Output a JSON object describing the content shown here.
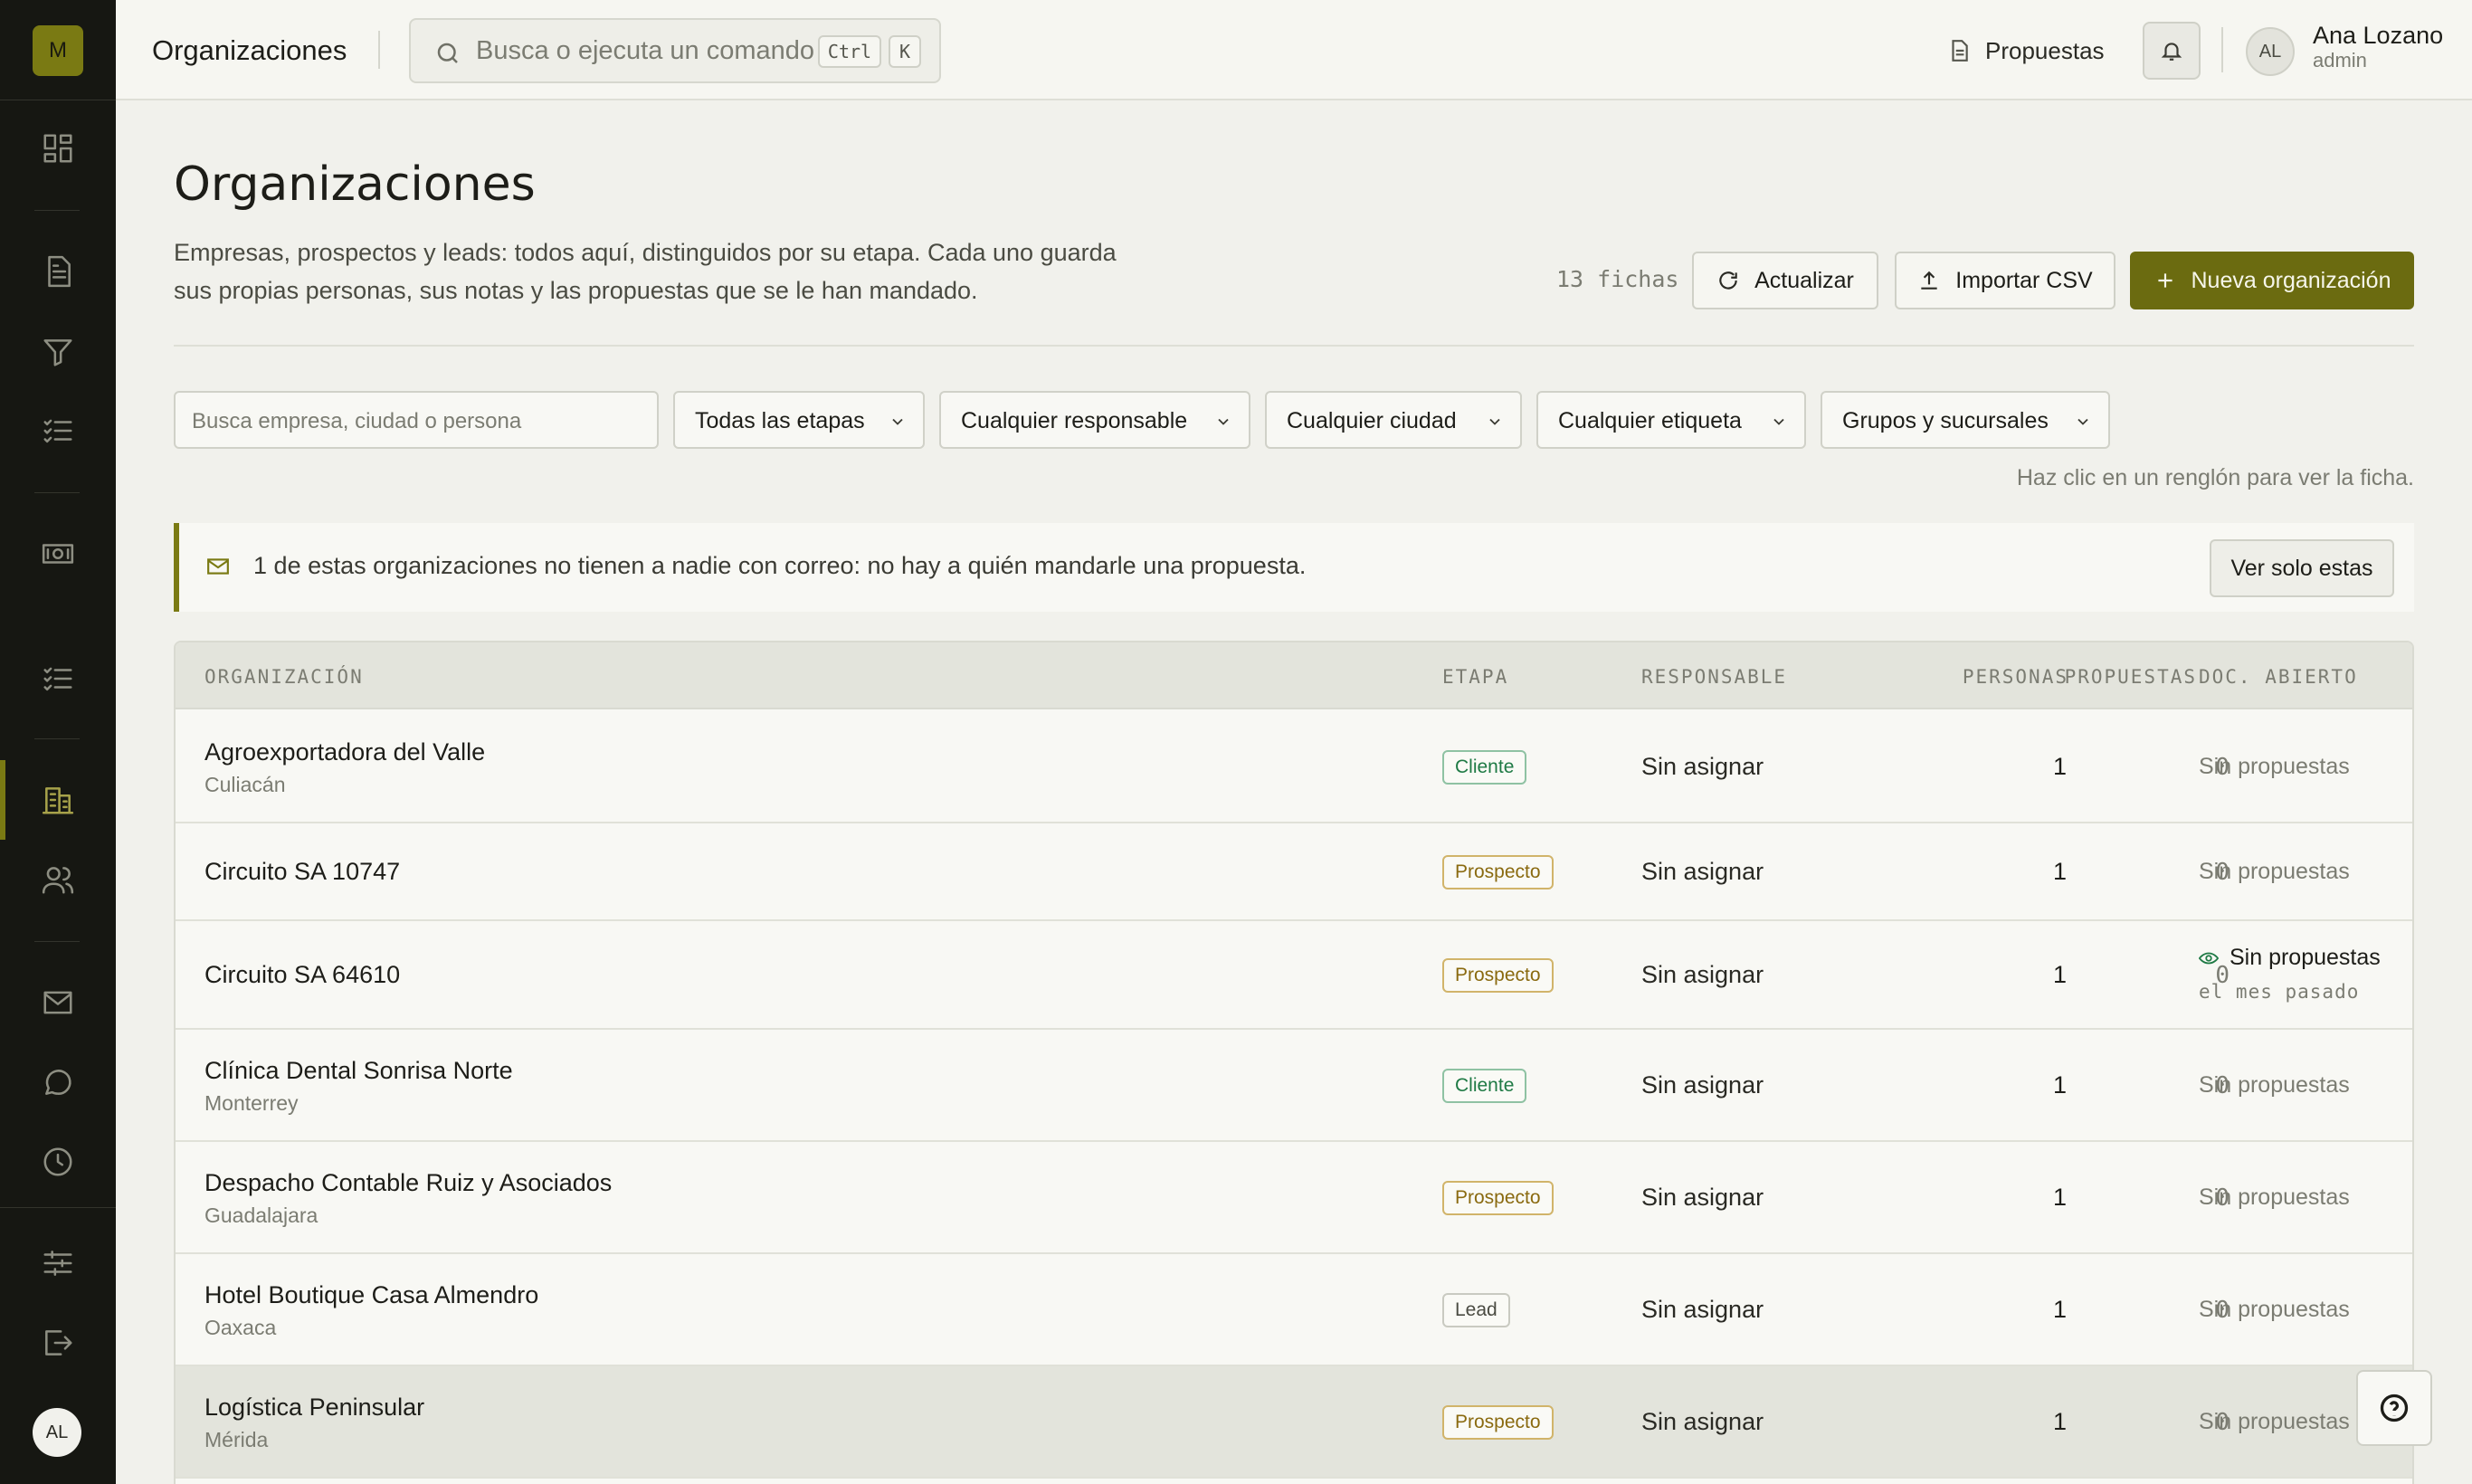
{
  "brand": {
    "logo_letter": "M"
  },
  "topbar": {
    "title": "Organizaciones",
    "search_placeholder": "Busca o ejecuta un comando",
    "kbd_ctrl": "Ctrl",
    "kbd_k": "K",
    "proposals_link": "Propuestas",
    "user_initials": "AL",
    "user_name": "Ana Lozano",
    "user_role": "admin"
  },
  "sidebar": {
    "icons": [
      "dashboard-icon",
      "document-icon",
      "funnel-icon",
      "checklist-icon",
      "banknote-icon",
      "tasks-icon",
      "building-icon",
      "people-icon",
      "mail-icon",
      "chat-icon",
      "clock-icon",
      "sliders-icon",
      "logout-icon"
    ],
    "active": "building-icon",
    "avatar_initials": "AL"
  },
  "page": {
    "title": "Organizaciones",
    "description": "Empresas, prospectos y leads: todos aquí, distinguidos por su etapa. Cada uno guarda sus propias personas, sus notas y las propuestas que se le han mandado.",
    "count": "13 fichas",
    "refresh_label": "Actualizar",
    "import_label": "Importar CSV",
    "new_label": "Nueva organización"
  },
  "filters": {
    "search_placeholder": "Busca empresa, ciudad o persona",
    "stage": "Todas las etapas",
    "owner": "Cualquier responsable",
    "city": "Cualquier ciudad",
    "tag": "Cualquier etiqueta",
    "groups": "Grupos y sucursales",
    "hint": "Haz clic en un renglón para ver la ficha."
  },
  "alert": {
    "count": "1",
    "message": "de estas organizaciones no tienen a nadie con correo: no hay a quién mandarle una propuesta.",
    "button": "Ver solo estas"
  },
  "table": {
    "headers": {
      "org": "ORGANIZACIÓN",
      "stage": "ETAPA",
      "owner": "RESPONSABLE",
      "people": "PERSONAS",
      "proposals": "PROPUESTAS",
      "doc": "DOC. ABIERTO"
    },
    "rows": [
      {
        "name": "Agroexportadora del Valle",
        "city": "Culiacán",
        "stage": "Cliente",
        "owner": "Sin asignar",
        "people": "1",
        "proposals": "0",
        "doc": "Sin propuestas",
        "doc_sub": ""
      },
      {
        "name": "Circuito SA 10747",
        "city": "",
        "stage": "Prospecto",
        "owner": "Sin asignar",
        "people": "1",
        "proposals": "0",
        "doc": "Sin propuestas",
        "doc_sub": ""
      },
      {
        "name": "Circuito SA 64610",
        "city": "",
        "stage": "Prospecto",
        "owner": "Sin asignar",
        "people": "1",
        "proposals": "0",
        "doc": "Sin propuestas",
        "doc_sub": "el mes pasado"
      },
      {
        "name": "Clínica Dental Sonrisa Norte",
        "city": "Monterrey",
        "stage": "Cliente",
        "owner": "Sin asignar",
        "people": "1",
        "proposals": "0",
        "doc": "Sin propuestas",
        "doc_sub": ""
      },
      {
        "name": "Despacho Contable Ruiz y Asociados",
        "city": "Guadalajara",
        "stage": "Prospecto",
        "owner": "Sin asignar",
        "people": "1",
        "proposals": "0",
        "doc": "Sin propuestas",
        "doc_sub": ""
      },
      {
        "name": "Hotel Boutique Casa Almendro",
        "city": "Oaxaca",
        "stage": "Lead",
        "owner": "Sin asignar",
        "people": "1",
        "proposals": "0",
        "doc": "Sin propuestas",
        "doc_sub": ""
      },
      {
        "name": "Logística Peninsular",
        "city": "Mérida",
        "stage": "Prospecto",
        "owner": "Sin asignar",
        "people": "1",
        "proposals": "0",
        "doc": "Sin propuestas",
        "doc_sub": ""
      }
    ]
  },
  "colors": {
    "accent": "#6b6b10",
    "sidebar_bg": "#161712",
    "cliente": "#1f7a45",
    "prospecto": "#8a6a10"
  }
}
